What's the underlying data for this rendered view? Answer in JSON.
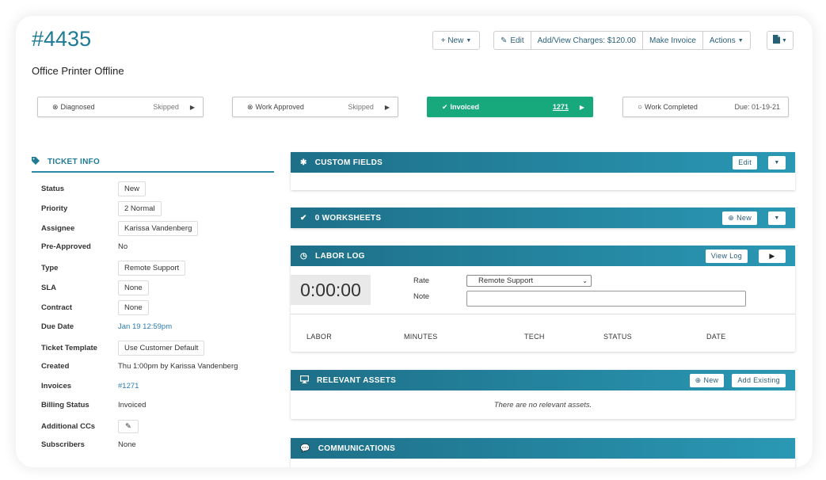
{
  "header": {
    "ticket_number": "#4435",
    "subject": "Office Printer Offline",
    "new_label": "+ New",
    "edit_label": "Edit",
    "charges_label": "Add/View Charges: $120.00",
    "make_invoice_label": "Make Invoice",
    "actions_label": "Actions",
    "pdf_icon": "pdf-icon"
  },
  "stages": [
    {
      "label": "Diagnosed",
      "value": "Skipped"
    },
    {
      "label": "Work Approved",
      "value": "Skipped"
    },
    {
      "label": "Invoiced",
      "value": "1271"
    },
    {
      "label": "Work Completed",
      "value": "Due: 01-19-21"
    }
  ],
  "ticket_info": {
    "title": "TICKET INFO",
    "rows": [
      {
        "label": "Status",
        "value": "New"
      },
      {
        "label": "Priority",
        "value": "2 Normal"
      },
      {
        "label": "Assignee",
        "value": "Karissa Vandenberg"
      },
      {
        "label": "Pre-Approved",
        "value": "No"
      },
      {
        "label": "Type",
        "value": "Remote Support"
      },
      {
        "label": "SLA",
        "value": "None"
      },
      {
        "label": "Contract",
        "value": "None"
      },
      {
        "label": "Due Date",
        "value": "Jan 19 12:59pm"
      },
      {
        "label": "Ticket Template",
        "value": "Use Customer Default"
      },
      {
        "label": "Created",
        "value": "Thu 1:00pm by Karissa Vandenberg"
      },
      {
        "label": "Invoices",
        "value": "#1271"
      },
      {
        "label": "Billing Status",
        "value": "Invoiced"
      },
      {
        "label": "Additional CCs",
        "value": ""
      },
      {
        "label": "Subscribers",
        "value": "None"
      }
    ]
  },
  "custom_fields": {
    "title": "CUSTOM FIELDS",
    "edit_label": "Edit"
  },
  "worksheets": {
    "title": "0 WORKSHEETS",
    "new_label": "New"
  },
  "labor_log": {
    "title": "LABOR LOG",
    "view_log_label": "View Log",
    "timer": "0:00:00",
    "rate_label": "Rate",
    "rate_value": "Remote Support",
    "note_label": "Note",
    "columns": [
      "LABOR",
      "MINUTES",
      "TECH",
      "STATUS",
      "DATE"
    ]
  },
  "relevant_assets": {
    "title": "RELEVANT ASSETS",
    "new_label": "New",
    "add_existing_label": "Add Existing",
    "empty_text": "There are no relevant assets."
  },
  "communications": {
    "title": "COMMUNICATIONS"
  },
  "colors": {
    "accent": "#1f7a94",
    "invoiced": "#17a87b",
    "header_gradient_start": "#1e6f88",
    "header_gradient_end": "#2a98b4"
  }
}
